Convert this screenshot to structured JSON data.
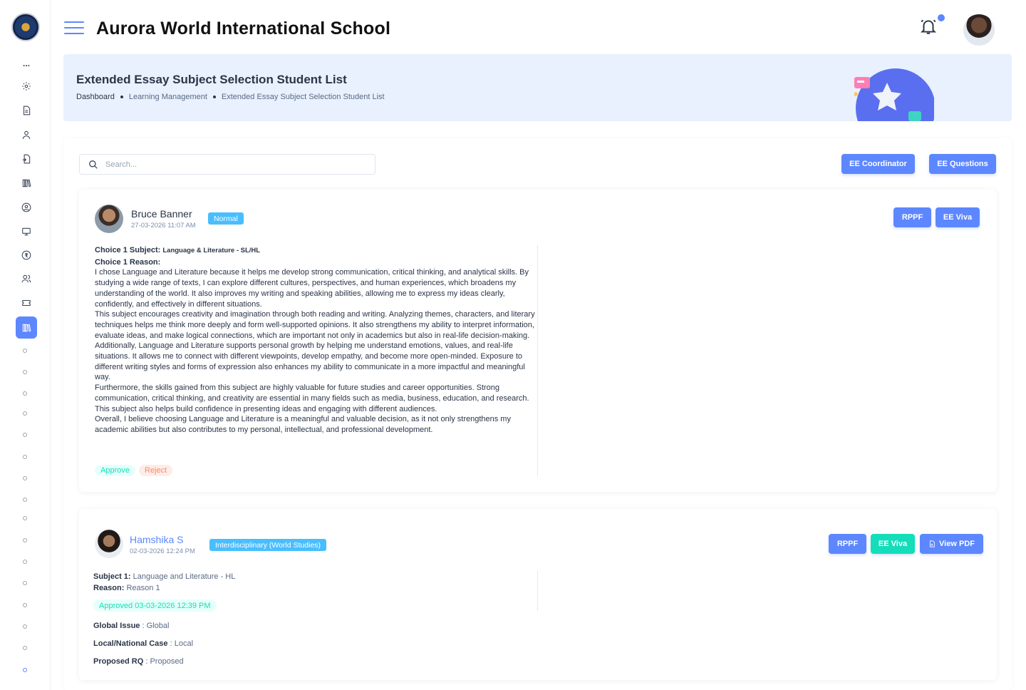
{
  "header": {
    "school_name": "Aurora World International School"
  },
  "banner": {
    "title": "Extended Essay Subject Selection Student List",
    "breadcrumbs": [
      "Dashboard",
      "Learning Management",
      "Extended Essay Subject Selection Student List"
    ]
  },
  "sidebar": {
    "more_label": "...",
    "icons": [
      "settings-icon",
      "document-icon",
      "user-icon",
      "file-transfer-icon",
      "library-icon",
      "user-circle-icon",
      "monitor-icon",
      "currency-icon",
      "users-icon",
      "ticket-icon",
      "books-icon"
    ]
  },
  "toolbar": {
    "search_placeholder": "Search...",
    "coordinator_label": "EE Coordinator",
    "questions_label": "EE Questions"
  },
  "students": [
    {
      "name": "Bruce Banner",
      "date": "27-03-2026 11:07 AM",
      "badge": "Normal",
      "rppf_label": "RPPF",
      "viva_label": "EE Viva",
      "choice1_subject_label": "Choice 1 Subject:",
      "choice1_subject": "Language & Literature - SL/HL",
      "choice1_reason_label": "Choice 1 Reason:",
      "paragraphs": [
        "I chose Language and Literature because it helps me develop strong communication, critical thinking, and analytical skills. By studying a wide range of texts, I can explore different cultures, perspectives, and human experiences, which broadens my understanding of the world. It also improves my writing and speaking abilities, allowing me to express my ideas clearly, confidently, and effectively in different situations.",
        "This subject encourages creativity and imagination through both reading and writing. Analyzing themes, characters, and literary techniques helps me think more deeply and form well-supported opinions. It also strengthens my ability to interpret information, evaluate ideas, and make logical connections, which are important not only in academics but also in real-life decision-making.",
        "Additionally, Language and Literature supports personal growth by helping me understand emotions, values, and real-life situations. It allows me to connect with different viewpoints, develop empathy, and become more open-minded. Exposure to different writing styles and forms of expression also enhances my ability to communicate in a more impactful and meaningful way.",
        "Furthermore, the skills gained from this subject are highly valuable for future studies and career opportunities. Strong communication, critical thinking, and creativity are essential in many fields such as media, business, education, and research. This subject also helps build confidence in presenting ideas and engaging with different audiences.",
        "Overall, I believe choosing Language and Literature is a meaningful and valuable decision, as it not only strengthens my academic abilities but also contributes to my personal, intellectual, and professional development."
      ],
      "approve_label": "Approve",
      "reject_label": "Reject"
    },
    {
      "name": "Hamshika S",
      "date": "02-03-2026 12:24 PM",
      "badge": "Interdisciplinary (World Studies)",
      "rppf_label": "RPPF",
      "viva_label": "EE Viva",
      "pdf_label": "View PDF",
      "subject_label": "Subject 1:",
      "subject": "Language and Literature - HL",
      "reason_label": "Reason:",
      "reason": "Reason 1",
      "approved_text": "Approved 03-03-2026 12:39 PM",
      "global_issue_label": "Global Issue",
      "global_issue": "Global",
      "local_case_label": "Local/National Case",
      "local_case": "Local",
      "proposed_rq_label": "Proposed RQ",
      "proposed_rq": "Proposed"
    }
  ],
  "colors": {
    "primary": "#5d87ff",
    "secondary": "#49beff",
    "success": "#13deb9",
    "danger": "#fa896b",
    "banner_bg": "#e8f1fd"
  }
}
